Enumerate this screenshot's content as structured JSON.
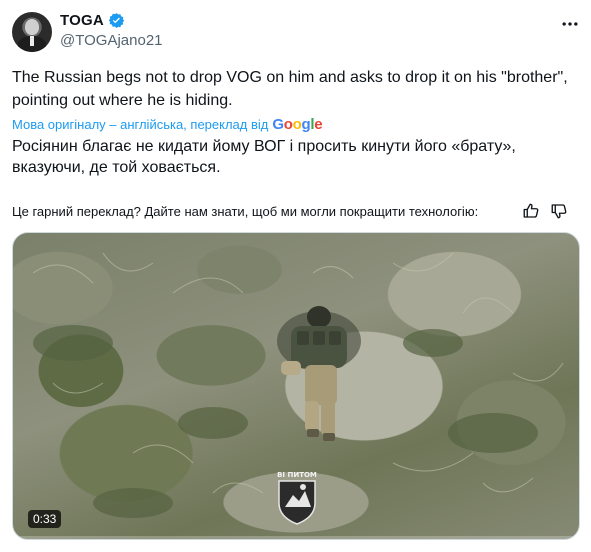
{
  "author": {
    "display_name": "TOGA",
    "handle": "@TOGAjano21"
  },
  "tweet": {
    "text": "The Russian begs not to drop VOG on him and asks to drop it on his \"brother\", pointing out where he is hiding.",
    "translate_label": "Мова оригіналу – англійська, переклад від",
    "translate_provider": "Google",
    "translated_text": "Росіянин благає не кидати йому ВОГ і просить кинути його «брату», вказуючи, де той ховається.",
    "feedback_prompt": "Це гарний переклад? Дайте нам знати, щоб ми могли покращити технологію:"
  },
  "media": {
    "duration": "0:33",
    "progress_fraction": 0.0,
    "watermark_text": "ВІ ПИТОМ"
  },
  "colors": {
    "accent": "#1d9bf0",
    "text_primary": "#0f1419",
    "text_secondary": "#536471"
  },
  "icons": {
    "verified": "verified-badge-icon",
    "more": "more-options-icon",
    "thumbs_up": "thumbs-up-icon",
    "thumbs_down": "thumbs-down-icon"
  }
}
